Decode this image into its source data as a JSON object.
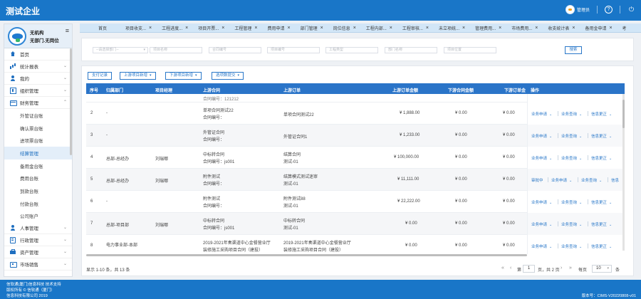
{
  "header": {
    "brand": "测试企业",
    "user_label": "管理员",
    "help_glyph": "?",
    "power_glyph": "⏻",
    "colors": {
      "bar": "#1976c8",
      "accent": "#2a74c8"
    }
  },
  "sidebar": {
    "org_name": "无机构",
    "dept_name": "无部门.无岗位",
    "menu_glyph": "≡",
    "items": [
      {
        "label": "首页",
        "icon": "home-icon",
        "chevron": ""
      },
      {
        "label": "统计报表",
        "icon": "chart-icon",
        "chevron": "⌄"
      },
      {
        "label": "我的",
        "icon": "user-icon",
        "chevron": "⌄"
      },
      {
        "label": "组织管理",
        "icon": "org-icon",
        "chevron": "⌄"
      },
      {
        "label": "财务管理",
        "icon": "finance-icon",
        "chevron": "⌃"
      }
    ],
    "finance_sub": [
      "外管证台账",
      "确认票台账",
      "进项票台账",
      "结算管理",
      "备用金台账",
      "费用台账",
      "到款台账",
      "付款台账",
      "公司账户"
    ],
    "active_sub": "结算管理",
    "bottom_items": [
      {
        "label": "人事管理",
        "icon": "personnel-icon",
        "chevron": "⌄"
      },
      {
        "label": "行政管理",
        "icon": "admin-icon",
        "chevron": "⌄"
      },
      {
        "label": "资产管理",
        "icon": "asset-icon",
        "chevron": "⌄"
      },
      {
        "label": "市场销售",
        "icon": "market-icon",
        "chevron": "⌄"
      }
    ]
  },
  "tabs": [
    "首页",
    "项目收支...",
    "工程进度...",
    "项目开票...",
    "工程管理",
    "费用申请",
    "部门管理",
    "岗位信息",
    "工程内部...",
    "工程审核...",
    "未立项统...",
    "管理费用...",
    "市场费用...",
    "收支统计表",
    "备用金申请",
    "考"
  ],
  "filters": {
    "dept_select": "--请选择部门--",
    "project_name": "项目名称",
    "contract_no": "合同编号",
    "project_no": "项目编号",
    "project_type": "工程类型",
    "dept_name": "部门名称",
    "project_location": "项目位置",
    "search_btn": "搜索"
  },
  "toolbar": {
    "pay_record": "支付记录",
    "upstream": "上游项目新增",
    "downstream": "下游项目新增",
    "submit": "选项数提交"
  },
  "table": {
    "headers": [
      "序号",
      "归属部门",
      "项目经理",
      "上游合同",
      "上游订单",
      "上游订单金额",
      "下游合同金额",
      "下游订单金",
      "操作"
    ],
    "clipped_text": "合同编号：121212",
    "rows": [
      {
        "idx": "2",
        "dept": "-",
        "pm": "",
        "up_contract": "单项合同测试22",
        "up_contract_no": "合同编号：",
        "up_order": "单项合同测试22",
        "up_order_sub": "",
        "up_amount": "¥ 1,888.00",
        "down_amount": "¥ 0.00",
        "down_order": "¥ 0.00",
        "ops": [
          "业务申请",
          "业务查询",
          "信息更正"
        ]
      },
      {
        "idx": "3",
        "dept": "-",
        "pm": "",
        "up_contract": "外管证合同",
        "up_contract_no": "合同编号：",
        "up_order": "外管证合同1",
        "up_order_sub": "",
        "up_amount": "¥ 1,233.00",
        "down_amount": "¥ 0.00",
        "down_order": "¥ 0.00",
        "ops": [
          "业务申请",
          "业务查询",
          "信息更正"
        ]
      },
      {
        "idx": "4",
        "dept": "总部-总经办",
        "pm": "刘瑞哪",
        "up_contract": "中标转合同",
        "up_contract_no": "合同编号：js001",
        "up_order": "结算合同",
        "up_order_sub": "测试-01",
        "up_amount": "¥ 100,000.00",
        "down_amount": "¥ 0.00",
        "down_order": "¥ 0.00",
        "ops": [
          "业务申请",
          "业务查询",
          "信息更正"
        ]
      },
      {
        "idx": "5",
        "dept": "总部-总经办",
        "pm": "刘瑞哪",
        "up_contract": "附件测试",
        "up_contract_no": "合同编号：",
        "up_order": "结算模式测试迷审",
        "up_order_sub": "测试-01",
        "up_amount": "¥ 11,111.00",
        "down_amount": "¥ 0.00",
        "down_order": "¥ 0.00",
        "ops": [
          "审批中",
          "业务申请",
          "业务查询",
          "信息"
        ]
      },
      {
        "idx": "6",
        "dept": "-",
        "pm": "",
        "up_contract": "附件测试",
        "up_contract_no": "合同编号：",
        "up_order": "附件测试88",
        "up_order_sub": "测试-01",
        "up_amount": "¥ 22,222.00",
        "down_amount": "¥ 0.00",
        "down_order": "¥ 0.00",
        "ops": [
          "业务申请",
          "业务查询",
          "信息更正"
        ]
      },
      {
        "idx": "7",
        "dept": "总部-项目部",
        "pm": "刘瑞哪",
        "up_contract": "中标转合同",
        "up_contract_no": "合同编号：js001",
        "up_order": "中标转合同",
        "up_order_sub": "测试-01",
        "up_amount": "¥ 0.00",
        "down_amount": "¥ 0.00",
        "down_order": "¥ 0.00",
        "ops": [
          "业务申请",
          "业务查询",
          "信息更正"
        ]
      },
      {
        "idx": "8",
        "dept": "电力事业部-本部",
        "pm": "",
        "up_contract": "2019-2021年奏渠道中心金餐营业厅",
        "up_contract_no": "装修施工采购项目合同（建投）",
        "up_order": "2019-2021年奏渠道中心金餐营业厅",
        "up_order_sub": "装修施工采购项目合同（建投）",
        "up_amount": "¥ 0.00",
        "down_amount": "¥ 0.00",
        "down_order": "¥ 0.00",
        "ops": [
          "业务申请",
          "业务查询",
          "信息更正"
        ]
      }
    ]
  },
  "pager": {
    "summary": "显示 1-10 条，共 13 条",
    "first": "«",
    "prev": "‹",
    "page_prefix": "第",
    "page_value": "1",
    "page_suffix": "页，共 2 页",
    "next": "›",
    "last": "»",
    "per_page_label": "每页",
    "per_page_value": "10",
    "per_page_unit": "条"
  },
  "footer": {
    "line1": "信软通(厦门)信息科技 技术支持",
    "line2": "版权所有 © 信软通（厦门）",
    "line3": "信息科技有限公司 2019",
    "version": "版本号：CIMS-V20220808-v01"
  }
}
